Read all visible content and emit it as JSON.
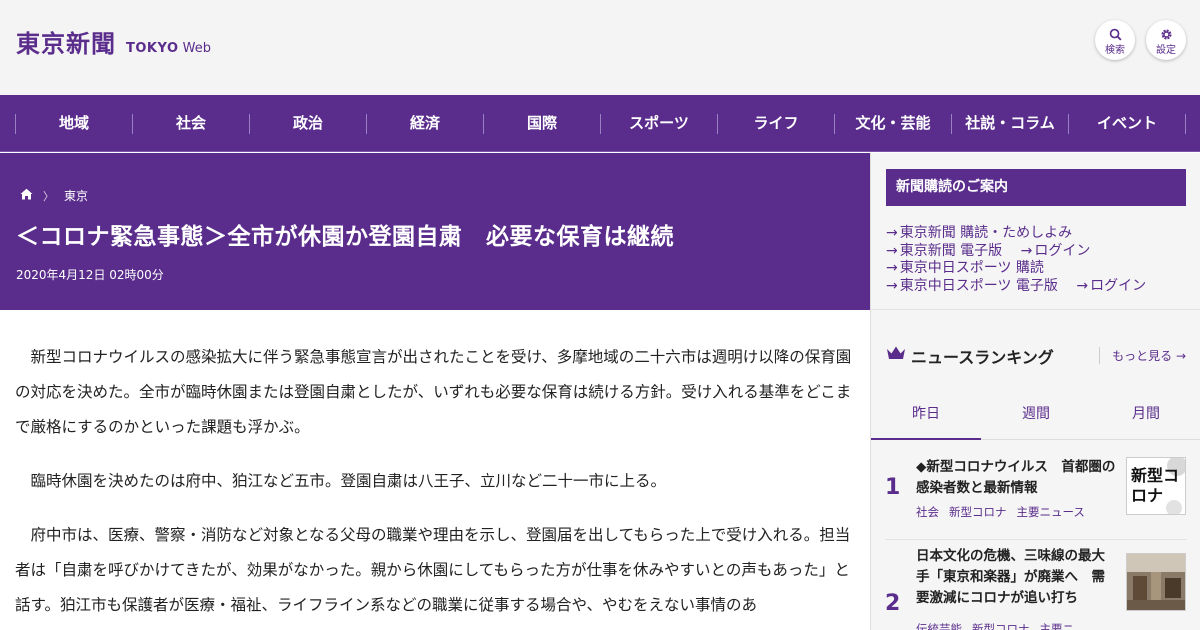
{
  "header": {
    "logo_main": "東京新聞",
    "logo_sub_bold": "TOKYO",
    "logo_sub_light": "Web",
    "search_label": "検索",
    "settings_label": "設定"
  },
  "nav": {
    "items": [
      "地域",
      "社会",
      "政治",
      "経済",
      "国際",
      "スポーツ",
      "ライフ",
      "文化・芸能",
      "社説・コラム",
      "イベント"
    ]
  },
  "breadcrumb": {
    "section": "東京"
  },
  "article": {
    "headline": "＜コロナ緊急事態＞全市が休園か登園自粛　必要な保育は継続",
    "date": "2020年4月12日 02時00分",
    "paragraphs": [
      "新型コロナウイルスの感染拡大に伴う緊急事態宣言が出されたことを受け、多摩地域の二十六市は週明け以降の保育園の対応を決めた。全市が臨時休園または登園自粛としたが、いずれも必要な保育は続ける方針。受け入れる基準をどこまで厳格にするのかといった課題も浮かぶ。",
      "臨時休園を決めたのは府中、狛江など五市。登園自粛は八王子、立川など二十一市に上る。",
      "府中市は、医療、警察・消防など対象となる父母の職業や理由を示し、登園届を出してもらった上で受け入れる。担当者は「自粛を呼びかけてきたが、効果がなかった。親から休園にしてもらった方が仕事を休みやすいとの声もあった」と話す。狛江市も保護者が医療・福祉、ライフライン系などの職業に従事する場合や、やむをえない事情のあ"
    ]
  },
  "sidebar": {
    "subscribe_title": "新聞購読のご案内",
    "links": {
      "line1": "東京新聞 購読・ためしよみ",
      "line2a": "東京新聞 電子版",
      "line2b": "ログイン",
      "line3": "東京中日スポーツ 購読",
      "line4a": "東京中日スポーツ 電子版",
      "line4b": "ログイン"
    },
    "ranking_title": "ニュースランキング",
    "more_label": "もっと見る",
    "tabs": [
      "昨日",
      "週間",
      "月間"
    ],
    "active_tab": "昨日",
    "items": [
      {
        "rank": "1",
        "title": "◆新型コロナウイルス　首都圏の感染者数と最新情報",
        "tags": [
          "社会",
          "新型コロナ",
          "主要ニュース"
        ],
        "thumb_text": "新型コロナ"
      },
      {
        "rank": "2",
        "title": "日本文化の危機、三味線の最大手「東京和楽器」が廃業へ　需要激減にコロナが追い打ち",
        "tags": [
          "伝統芸能",
          "新型コロナ",
          "主要ニ"
        ]
      }
    ]
  },
  "colors": {
    "brand_purple": "#5a2d8c",
    "header_bg": "#f4f4f4",
    "sidebar_bg": "#f5f5f5"
  }
}
